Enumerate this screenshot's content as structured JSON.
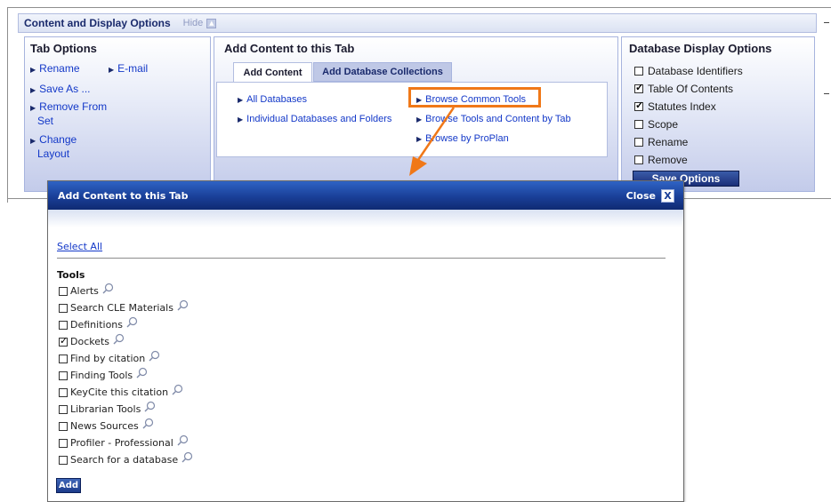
{
  "content_display": {
    "title": "Content and Display Options",
    "hide_label": "Hide"
  },
  "tab_options": {
    "title": "Tab Options",
    "links": [
      "Rename",
      "E-mail",
      "Save As ...",
      "Remove From",
      "Set",
      "Change",
      "Layout"
    ]
  },
  "add_content": {
    "title": "Add Content to this Tab",
    "tabs": [
      "Add Content",
      "Add Database Collections"
    ],
    "links_left": [
      "All Databases",
      "Individual Databases and Folders"
    ],
    "links_right": [
      "Browse Common Tools",
      "Browse Tools and Content by Tab",
      "Browse by ProPlan"
    ]
  },
  "db_display": {
    "title": "Database Display Options",
    "options": [
      {
        "label": "Database Identifiers",
        "checked": false
      },
      {
        "label": "Table Of Contents",
        "checked": true
      },
      {
        "label": "Statutes Index",
        "checked": true
      },
      {
        "label": "Scope",
        "checked": false
      },
      {
        "label": "Rename",
        "checked": false
      },
      {
        "label": "Remove",
        "checked": false
      }
    ],
    "save_label": "Save Options"
  },
  "modal": {
    "title": "Add Content to this Tab",
    "close_label": "Close",
    "close_x": "X",
    "select_all": "Select All",
    "tools_heading": "Tools",
    "tools": [
      {
        "label": "Alerts",
        "checked": false
      },
      {
        "label": "Search CLE Materials",
        "checked": false
      },
      {
        "label": "Definitions",
        "checked": false
      },
      {
        "label": "Dockets",
        "checked": true
      },
      {
        "label": "Find by citation",
        "checked": false
      },
      {
        "label": "Finding Tools",
        "checked": false
      },
      {
        "label": "KeyCite this citation",
        "checked": false
      },
      {
        "label": "Librarian Tools",
        "checked": false
      },
      {
        "label": "News Sources",
        "checked": false
      },
      {
        "label": "Profiler - Professional",
        "checked": false
      },
      {
        "label": "Search for a database",
        "checked": false
      }
    ],
    "add_label": "Add"
  },
  "colors": {
    "highlight": "#f07818",
    "link": "#1338c8",
    "modal_header": "#1a3f98"
  }
}
